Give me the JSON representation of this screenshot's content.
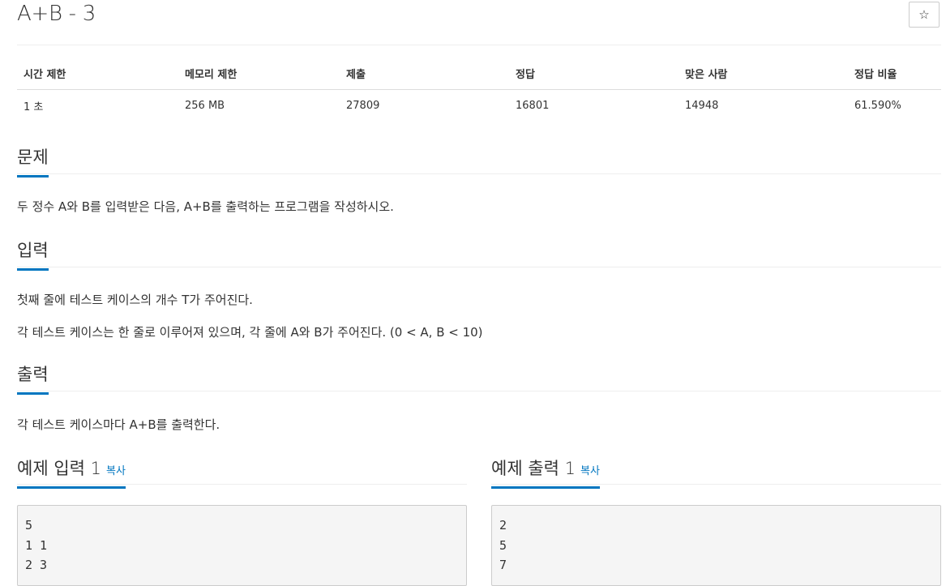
{
  "problem": {
    "title": "A+B - 3",
    "star_icon": "☆"
  },
  "info_table": {
    "headers": [
      "시간 제한",
      "메모리 제한",
      "제출",
      "정답",
      "맞은 사람",
      "정답 비율"
    ],
    "values": [
      "1 초",
      "256 MB",
      "27809",
      "16801",
      "14948",
      "61.590%"
    ]
  },
  "sections": {
    "problem": {
      "heading": "문제",
      "text": "두 정수 A와 B를 입력받은 다음, A+B를 출력하는 프로그램을 작성하시오."
    },
    "input": {
      "heading": "입력",
      "lines": [
        "첫째 줄에 테스트 케이스의 개수 T가 주어진다.",
        "각 테스트 케이스는 한 줄로 이루어져 있으며, 각 줄에 A와 B가 주어진다. (0 < A, B < 10)"
      ]
    },
    "output": {
      "heading": "출력",
      "text": "각 테스트 케이스마다 A+B를 출력한다."
    }
  },
  "examples": {
    "input": {
      "heading": "예제 입력 1",
      "copy_label": "복사",
      "content": "5\n1 1\n2 3"
    },
    "output": {
      "heading": "예제 출력 1",
      "copy_label": "복사",
      "content": "2\n5\n7"
    }
  }
}
